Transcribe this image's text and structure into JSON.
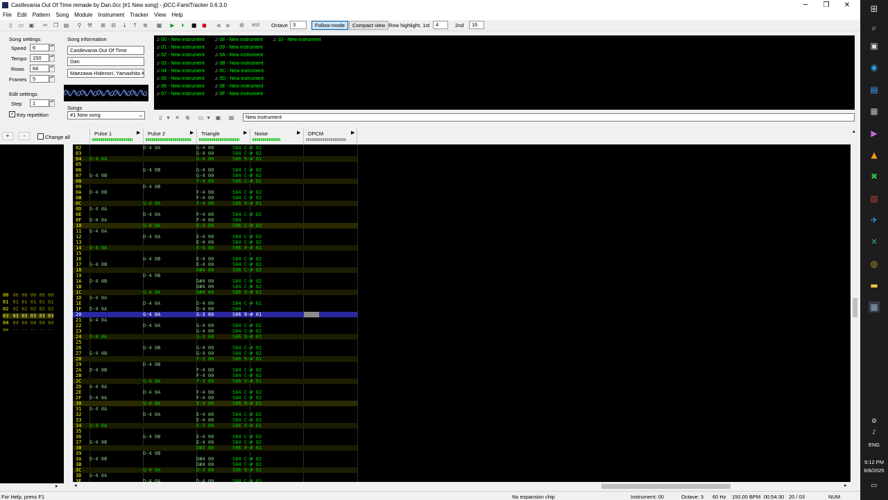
{
  "window": {
    "title": "Castlevania Out Of Time remade by Dan.0cc [#1 New song] - j0CC-FamiTracker 0.6.3.0",
    "minimize": "─",
    "maximize": "❐",
    "close": "✕"
  },
  "menu": [
    "File",
    "Edit",
    "Pattern",
    "Song",
    "Module",
    "Instrument",
    "Tracker",
    "View",
    "Help"
  ],
  "toolbar": {
    "octave_label": "Octave",
    "octave_value": "3",
    "follow_mode": "Follow-mode",
    "compact_view": "Compact view",
    "row_highlight_label": "Row highlight, 1st",
    "row_highlight_1st": "4",
    "second_label": "2nd",
    "row_highlight_2nd": "16"
  },
  "song_settings": {
    "header": "Song settings",
    "speed_label": "Speed",
    "speed": "6",
    "tempo_label": "Tempo",
    "tempo": "150",
    "rows_label": "Rows",
    "rows": "64",
    "frames_label": "Frames",
    "frames": "5"
  },
  "edit_settings": {
    "header": "Edit settings",
    "step_label": "Step",
    "step": "1",
    "key_repetition": "Key repetition",
    "key_repetition_checked": true
  },
  "song_info": {
    "header": "Song information",
    "title": "Castlevania Out Of Time",
    "author": "Dan",
    "copyright": "Maezawa Hidenori, Yamashita K."
  },
  "songs": {
    "header": "Songs",
    "selected": "#1 New song"
  },
  "instruments": [
    "00 - New instrument",
    "01 - New instrument",
    "02 - New instrument",
    "03 - New instrument",
    "04 - New instrument",
    "05 - New instrument",
    "06 - New instrument",
    "07 - New instrument",
    "08 - New instrument",
    "09 - New instrument",
    "0A - New instrument",
    "0B - New instrument",
    "0C - New instrument",
    "0D - New instrument",
    "0E - New instrument",
    "0F - New instrument",
    "10 - New instrument"
  ],
  "instrument_name": "New instrument",
  "frame_controls": {
    "add": "+",
    "remove": "-",
    "change_all": "Change all"
  },
  "channels": [
    "Pulse 1",
    "Pulse 2",
    "Triangle",
    "Noise",
    "DPCM"
  ],
  "frames": [
    {
      "num": "00",
      "values": "00 00 00 00 00"
    },
    {
      "num": "01",
      "values": "01 01 01 01 01"
    },
    {
      "num": "02",
      "values": "02 02 02 02 02"
    },
    {
      "num": "03",
      "values": "03 03 03 03 03"
    },
    {
      "num": "04",
      "values": "04 04 04 04 04"
    },
    {
      "num": ">>",
      "values": "-- -- -- -- --"
    }
  ],
  "pattern_rows": [
    {
      "n": "02",
      "p1": "",
      "p2": "D-4 0A",
      "tr": "G-4 00",
      "no": "S04 C-# 02"
    },
    {
      "n": "03",
      "p1": "",
      "p2": "",
      "tr": "G-4 00",
      "no": "S04 C-# 02"
    },
    {
      "n": "04",
      "p1": "D-4 0A",
      "p2": "",
      "tr": "G-4 00",
      "no": "S06 9-# 01"
    },
    {
      "n": "05",
      "p1": "",
      "p2": "",
      "tr": "",
      "no": ""
    },
    {
      "n": "06",
      "p1": "",
      "p2": "G-4 0B",
      "tr": "G-4 00",
      "no": "S04 C-# 02"
    },
    {
      "n": "07",
      "p1": "G-4 0B",
      "p2": "",
      "tr": "G-4 00",
      "no": "S04 C-# 02"
    },
    {
      "n": "08",
      "p1": "",
      "p2": "",
      "tr": "F-4 00",
      "no": "S06 C-# 02"
    },
    {
      "n": "09",
      "p1": "",
      "p2": "D-4 0B",
      "tr": "",
      "no": ""
    },
    {
      "n": "0A",
      "p1": "D-4 0B",
      "p2": "",
      "tr": "F-4 00",
      "no": "S04 C-# 02"
    },
    {
      "n": "0B",
      "p1": "",
      "p2": "",
      "tr": "F-4 00",
      "no": "S04 C-# 02"
    },
    {
      "n": "0C",
      "p1": "",
      "p2": "G-4 0A",
      "tr": "F-4 00",
      "no": "S06 9-# 01"
    },
    {
      "n": "0D",
      "p1": "G-4 0A",
      "p2": "",
      "tr": "",
      "no": ""
    },
    {
      "n": "0E",
      "p1": "",
      "p2": "D-4 0A",
      "tr": "F-4 00",
      "no": "S04 C-# 02"
    },
    {
      "n": "0F",
      "p1": "D-4 0A",
      "p2": "",
      "tr": "F-4 00",
      "no": "S04"
    },
    {
      "n": "10",
      "p1": "",
      "p2": "G-4 0A",
      "tr": "E-4 00",
      "no": "S06 C-# 02"
    },
    {
      "n": "11",
      "p1": "G-4 0A",
      "p2": "",
      "tr": "",
      "no": ""
    },
    {
      "n": "12",
      "p1": "",
      "p2": "D-4 0A",
      "tr": "E-4 00",
      "no": "S04 C-# 02"
    },
    {
      "n": "13",
      "p1": "",
      "p2": "",
      "tr": "E-4 00",
      "no": "S04 C-# 02"
    },
    {
      "n": "14",
      "p1": "D-4 0A",
      "p2": "",
      "tr": "E-4 00",
      "no": "S06 9-# 01"
    },
    {
      "n": "15",
      "p1": "",
      "p2": "",
      "tr": "",
      "no": ""
    },
    {
      "n": "16",
      "p1": "",
      "p2": "G-4 0B",
      "tr": "E-4 00",
      "no": "S04 C-# 02"
    },
    {
      "n": "17",
      "p1": "G-4 0B",
      "p2": "",
      "tr": "E-4 00",
      "no": "S04 C-# 02"
    },
    {
      "n": "18",
      "p1": "",
      "p2": "",
      "tr": "D#4 00",
      "no": "S06 C-# 02"
    },
    {
      "n": "19",
      "p1": "",
      "p2": "D-4 0B",
      "tr": "",
      "no": ""
    },
    {
      "n": "1A",
      "p1": "D-4 0B",
      "p2": "",
      "tr": "D#4 00",
      "no": "S04 C-# 02"
    },
    {
      "n": "1B",
      "p1": "",
      "p2": "",
      "tr": "D#4 00",
      "no": "S04 C-# 02"
    },
    {
      "n": "1C",
      "p1": "",
      "p2": "G-4 0A",
      "tr": "D#4 00",
      "no": "S06 9-# 01"
    },
    {
      "n": "1D",
      "p1": "G-4 0A",
      "p2": "",
      "tr": "",
      "no": ""
    },
    {
      "n": "1E",
      "p1": "",
      "p2": "D-4 0A",
      "tr": "D-4 00",
      "no": "S04 C-# 01"
    },
    {
      "n": "1F",
      "p1": "D-4 0A",
      "p2": "",
      "tr": "D-4 00",
      "no": "S04"
    },
    {
      "n": "20",
      "p1": "",
      "p2": "G-4 0A",
      "tr": "G-3 00",
      "no": "S06 9-# 01"
    },
    {
      "n": "21",
      "p1": "G-4 0A",
      "p2": "",
      "tr": "",
      "no": ""
    },
    {
      "n": "22",
      "p1": "",
      "p2": "D-4 0A",
      "tr": "G-4 00",
      "no": "S04 C-# 02"
    },
    {
      "n": "23",
      "p1": "",
      "p2": "",
      "tr": "G-4 00",
      "no": "S04 C-# 02"
    },
    {
      "n": "24",
      "p1": "D-4 0A",
      "p2": "",
      "tr": "G-3 00",
      "no": "S06 9-# 01"
    },
    {
      "n": "25",
      "p1": "",
      "p2": "",
      "tr": "",
      "no": ""
    },
    {
      "n": "26",
      "p1": "",
      "p2": "G-4 0B",
      "tr": "G-4 00",
      "no": "S04 C-# 02"
    },
    {
      "n": "27",
      "p1": "G-4 0B",
      "p2": "",
      "tr": "G-4 00",
      "no": "S04 C-# 02"
    },
    {
      "n": "28",
      "p1": "",
      "p2": "",
      "tr": "F-3 00",
      "no": "S06 9-# 01"
    },
    {
      "n": "29",
      "p1": "",
      "p2": "D-4 0B",
      "tr": "",
      "no": ""
    },
    {
      "n": "2A",
      "p1": "D-4 0B",
      "p2": "",
      "tr": "F-4 00",
      "no": "S04 C-# 02"
    },
    {
      "n": "2B",
      "p1": "",
      "p2": "",
      "tr": "F-4 00",
      "no": "S04 C-# 02"
    },
    {
      "n": "2C",
      "p1": "",
      "p2": "G-4 0A",
      "tr": "F-3 00",
      "no": "S06 9-# 01"
    },
    {
      "n": "2D",
      "p1": "G-4 0A",
      "p2": "",
      "tr": "",
      "no": ""
    },
    {
      "n": "2E",
      "p1": "",
      "p2": "D-4 0A",
      "tr": "F-4 00",
      "no": "S04 C-# 02"
    },
    {
      "n": "2F",
      "p1": "D-4 0A",
      "p2": "",
      "tr": "F-4 00",
      "no": "S04 C-# 02"
    },
    {
      "n": "30",
      "p1": "",
      "p2": "G-4 0A",
      "tr": "E-3 00",
      "no": "S06 9-# 01"
    },
    {
      "n": "31",
      "p1": "G-4 0A",
      "p2": "",
      "tr": "",
      "no": ""
    },
    {
      "n": "32",
      "p1": "",
      "p2": "D-4 0A",
      "tr": "E-4 00",
      "no": "S04 C-# 02"
    },
    {
      "n": "33",
      "p1": "",
      "p2": "",
      "tr": "E-4 00",
      "no": "S04 C-# 02"
    },
    {
      "n": "34",
      "p1": "D-4 0A",
      "p2": "",
      "tr": "E-3 00",
      "no": "S06 9-# 01"
    },
    {
      "n": "35",
      "p1": "",
      "p2": "",
      "tr": "",
      "no": ""
    },
    {
      "n": "36",
      "p1": "",
      "p2": "G-4 0B",
      "tr": "E-4 00",
      "no": "S04 C-# 02"
    },
    {
      "n": "37",
      "p1": "G-4 0B",
      "p2": "",
      "tr": "E-4 00",
      "no": "S04 C-# 02"
    },
    {
      "n": "38",
      "p1": "",
      "p2": "",
      "tr": "D#3 00",
      "no": "S06 9-# 01"
    },
    {
      "n": "39",
      "p1": "",
      "p2": "D-4 0B",
      "tr": "",
      "no": ""
    },
    {
      "n": "3A",
      "p1": "D-4 0B",
      "p2": "",
      "tr": "D#4 00",
      "no": "S04 C-# 02"
    },
    {
      "n": "3B",
      "p1": "",
      "p2": "",
      "tr": "D#4 00",
      "no": "S04 C-# 02"
    },
    {
      "n": "3C",
      "p1": "",
      "p2": "G-4 0A",
      "tr": "D-3 00",
      "no": "S06 9-# 01"
    },
    {
      "n": "3D",
      "p1": "G-4 0A",
      "p2": "",
      "tr": "",
      "no": ""
    },
    {
      "n": "3E",
      "p1": "",
      "p2": "D-4 0A",
      "tr": "D-4 00",
      "no": "S04 C-# 01"
    }
  ],
  "status": {
    "help": "For Help, press F1",
    "expansion": "No expansion chip",
    "instrument": "Instrument: 00",
    "octave": "Octave: 3",
    "rate": "60 Hz",
    "bpm": "150.00 BPM",
    "time": "00:54:30",
    "position": "20 / 03",
    "num": "NUM"
  },
  "taskbar": {
    "lang": "ENG",
    "time": "9:12 PM",
    "date": "6/8/2025"
  }
}
